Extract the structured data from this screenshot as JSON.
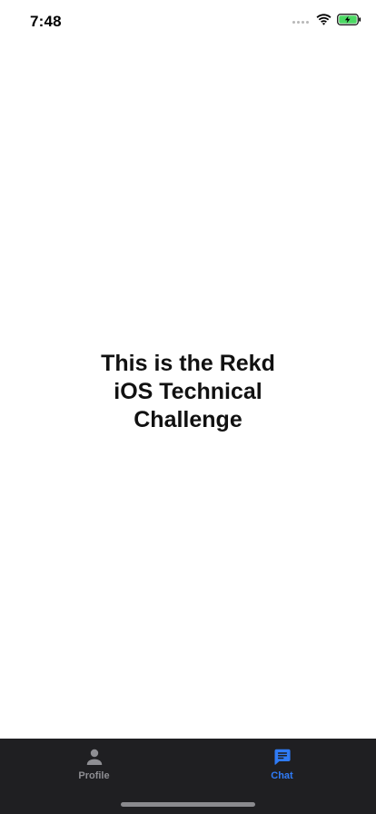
{
  "status_bar": {
    "time": "7:48"
  },
  "main": {
    "headline": "This is the Rekd iOS Technical Challenge"
  },
  "tab_bar": {
    "tabs": [
      {
        "label": "Profile",
        "icon": "person-icon",
        "selected": false
      },
      {
        "label": "Chat",
        "icon": "chat-icon",
        "selected": true
      }
    ]
  },
  "colors": {
    "accent": "#2f7bf6",
    "tab_bar_background": "#1f1f22",
    "inactive_tab": "#8e8e93",
    "battery_fill": "#4cd964"
  }
}
